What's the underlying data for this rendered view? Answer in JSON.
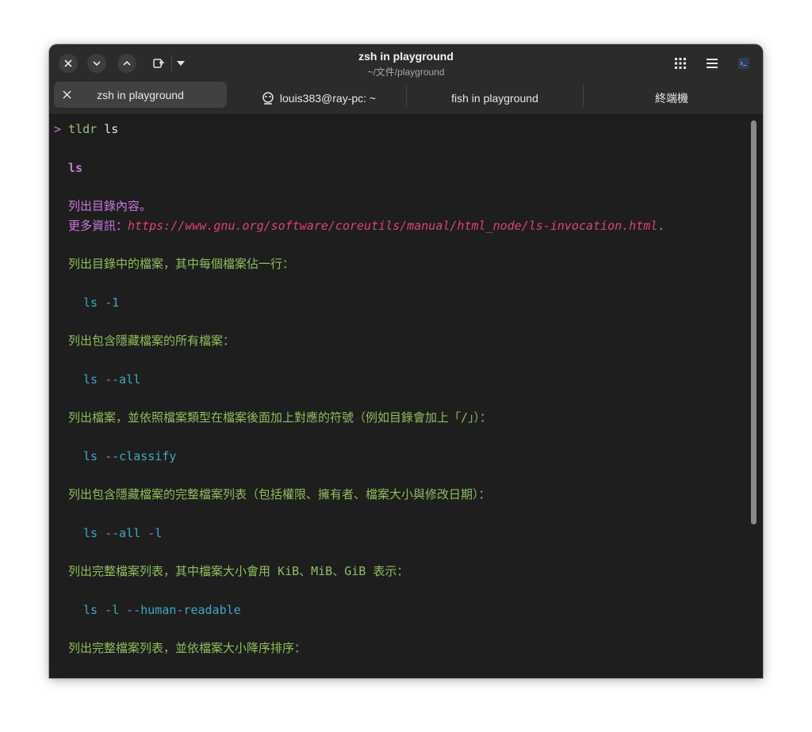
{
  "window": {
    "title": "zsh in playground",
    "subtitle": "~/文件/playground"
  },
  "tabs": [
    {
      "label": "zsh in playground",
      "active": true
    },
    {
      "label": "louis383@ray-pc: ~",
      "active": false
    },
    {
      "label": "fish in playground",
      "active": false
    },
    {
      "label": "終端機",
      "active": false
    }
  ],
  "terminal": {
    "prompt_symbol": ">",
    "command": "tldr",
    "command_arg": "ls",
    "page_name": "ls",
    "description": "列出目錄內容。",
    "more_info_label": "更多資訊：",
    "more_info_url": "https://www.gnu.org/software/coreutils/manual/html_node/ls-invocation.html",
    "more_info_end": ".",
    "examples": [
      {
        "desc": "列出目錄中的檔案，其中每個檔案佔一行：",
        "code": "ls -1"
      },
      {
        "desc": "列出包含隱藏檔案的所有檔案：",
        "code": "ls --all"
      },
      {
        "desc": "列出檔案，並依照檔案類型在檔案後面加上對應的符號（例如目錄會加上「/」）：",
        "code": "ls --classify"
      },
      {
        "desc": "列出包含隱藏檔案的完整檔案列表（包括權限、擁有者、檔案大小與修改日期）：",
        "code": "ls --all -l"
      },
      {
        "desc": "列出完整檔案列表，其中檔案大小會用 KiB、MiB、GiB 表示：",
        "code": "ls -l --human-readable"
      },
      {
        "desc": "列出完整檔案列表，並依檔案大小降序排序：",
        "code": ""
      }
    ]
  },
  "colors": {
    "prompt": "#c678dd",
    "command": "#98c379",
    "description": "#c678dd",
    "link": "#e0446b",
    "example_desc": "#8fbf5a",
    "example_code": "#3fa8c4"
  }
}
